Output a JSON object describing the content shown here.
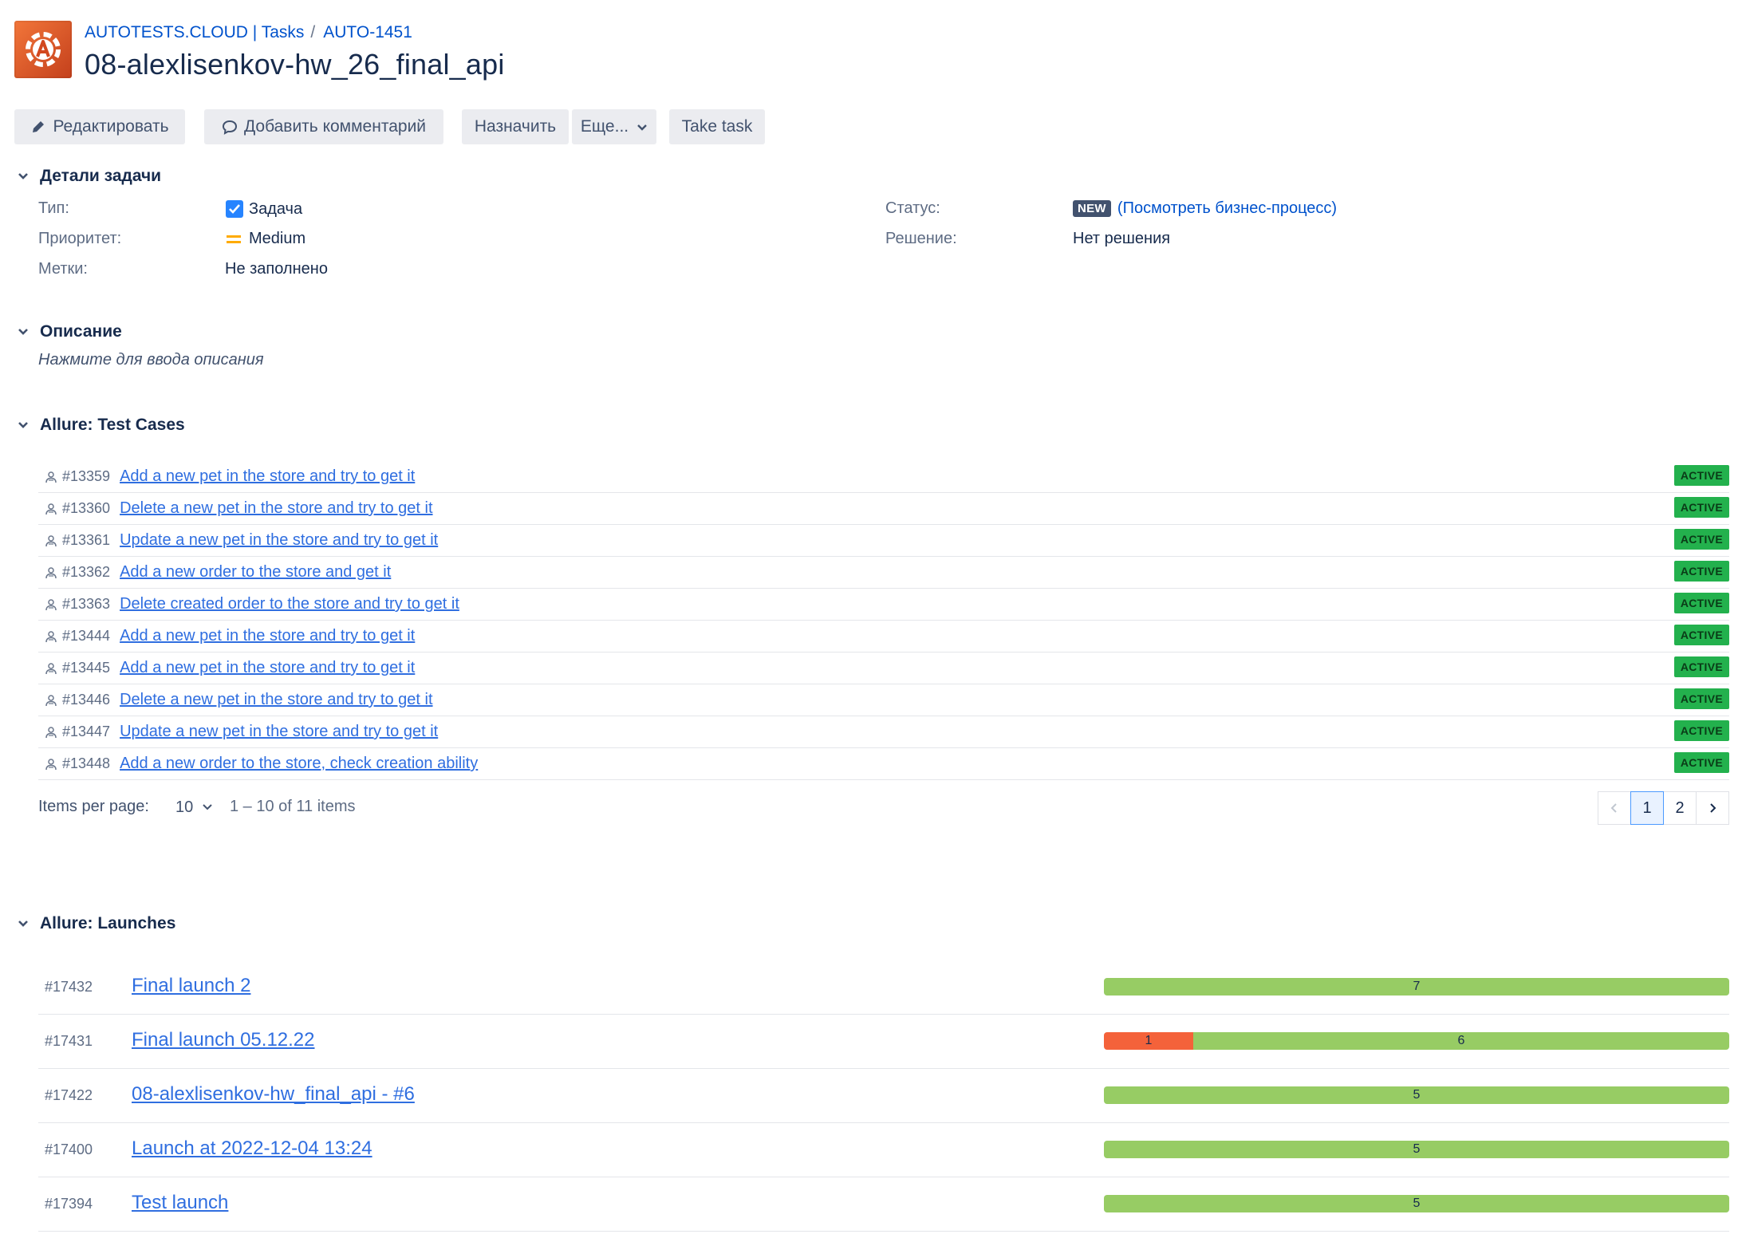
{
  "header": {
    "breadcrumb_project": "AUTOTESTS.CLOUD | Tasks",
    "breadcrumb_separator": "/",
    "breadcrumb_issue_key": "AUTO-1451",
    "issue_title": "08-alexlisenkov-hw_26_final_api",
    "project_avatar_icon": "autotests-cloud-logo-icon",
    "avatar_color": "#e15a2b"
  },
  "toolbar": {
    "edit_label": "Редактировать",
    "comment_label": "Добавить комментарий",
    "assign_label": "Назначить",
    "more_label": "Еще...",
    "take_task_label": "Take task"
  },
  "details": {
    "section_title": "Детали задачи",
    "type_label": "Тип:",
    "type_value": "Задача",
    "priority_label": "Приоритет:",
    "priority_value": "Medium",
    "labels_label": "Метки:",
    "labels_value": "Не заполнено",
    "status_label": "Статус:",
    "status_value": "NEW",
    "workflow_link": "(Посмотреть бизнес-процесс)",
    "resolution_label": "Решение:",
    "resolution_value": "Нет решения"
  },
  "description": {
    "section_title": "Описание",
    "placeholder": "Нажмите для ввода описания"
  },
  "test_cases": {
    "section_title": "Allure: Test Cases",
    "status_color": "#23b14d",
    "rows": [
      {
        "id": "#13359",
        "name": "Add a new pet in the store and try to get it",
        "status": "ACTIVE"
      },
      {
        "id": "#13360",
        "name": "Delete a new pet in the store and try to get it",
        "status": "ACTIVE"
      },
      {
        "id": "#13361",
        "name": "Update a new pet in the store and try to get it",
        "status": "ACTIVE"
      },
      {
        "id": "#13362",
        "name": "Add a new order to the store and get it",
        "status": "ACTIVE"
      },
      {
        "id": "#13363",
        "name": "Delete created order to the store and try to get it",
        "status": "ACTIVE"
      },
      {
        "id": "#13444",
        "name": "Add a new pet in the store and try to get it",
        "status": "ACTIVE"
      },
      {
        "id": "#13445",
        "name": "Add a new pet in the store and try to get it",
        "status": "ACTIVE"
      },
      {
        "id": "#13446",
        "name": "Delete a new pet in the store and try to get it",
        "status": "ACTIVE"
      },
      {
        "id": "#13447",
        "name": "Update a new pet in the store and try to get it",
        "status": "ACTIVE"
      },
      {
        "id": "#13448",
        "name": "Add a new order to the store, check creation ability",
        "status": "ACTIVE"
      }
    ],
    "pagination": {
      "items_per_page_label": "Items per page:",
      "page_size": "10",
      "range": "1 – 10 of 11 items",
      "pages": [
        "1",
        "2"
      ],
      "current_page": "1"
    }
  },
  "launches": {
    "section_title": "Allure: Launches",
    "failed_color": "#f4623a",
    "passed_color": "#97cc64",
    "rows": [
      {
        "id": "#17432",
        "name": "Final launch 2",
        "failed": 0,
        "passed": 7
      },
      {
        "id": "#17431",
        "name": "Final launch 05.12.22",
        "failed": 1,
        "passed": 6
      },
      {
        "id": "#17422",
        "name": "08-alexlisenkov-hw_final_api - #6",
        "failed": 0,
        "passed": 5
      },
      {
        "id": "#17400",
        "name": "Launch at 2022-12-04 13:24",
        "failed": 0,
        "passed": 5
      },
      {
        "id": "#17394",
        "name": "Test launch",
        "failed": 0,
        "passed": 5
      }
    ]
  }
}
